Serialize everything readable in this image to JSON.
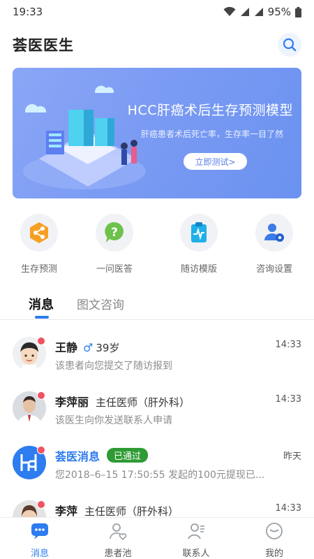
{
  "status_bar": {
    "time": "19:33",
    "battery": "95%"
  },
  "header": {
    "title": "荟医医生"
  },
  "banner": {
    "title": "HCC肝癌术后生存预测模型",
    "subtitle": "肝癌患者术后死亡率，生存率一目了然",
    "button_label": "立即测试>"
  },
  "quick_actions": [
    {
      "label": "生存预测",
      "icon": "share-nodes-icon"
    },
    {
      "label": "一问医答",
      "icon": "question-bubble-icon"
    },
    {
      "label": "随访模版",
      "icon": "clipboard-pulse-icon"
    },
    {
      "label": "咨询设置",
      "icon": "user-gear-icon"
    }
  ],
  "tabs": [
    {
      "label": "消息",
      "active": true
    },
    {
      "label": "图文咨询",
      "active": false
    }
  ],
  "messages": [
    {
      "name": "王静",
      "gender": "♂",
      "age": "39岁",
      "time": "14:33",
      "text": "该患者向您提交了随访报到"
    },
    {
      "name": "李萍丽",
      "title": "主任医师（肝外科）",
      "time": "14:33",
      "text": "该医生向你发送联系人申请"
    },
    {
      "name": "荟医消息",
      "badge": "已通过",
      "time": "昨天",
      "text": "您2018–6–15  17:50:55 发起的100元提现已..."
    },
    {
      "name": "李萍",
      "title": "主任医师（肝外科）",
      "time": "14:33",
      "text": ""
    }
  ],
  "tabbar": [
    {
      "label": "消息",
      "active": true
    },
    {
      "label": "患者池",
      "active": false
    },
    {
      "label": "联系人",
      "active": false
    },
    {
      "label": "我的",
      "active": false
    }
  ],
  "colors": {
    "accent": "#2d7cf0",
    "unread_dot": "#f05261",
    "badge_green": "#2e9b34",
    "banner": "#7b9bf3"
  }
}
